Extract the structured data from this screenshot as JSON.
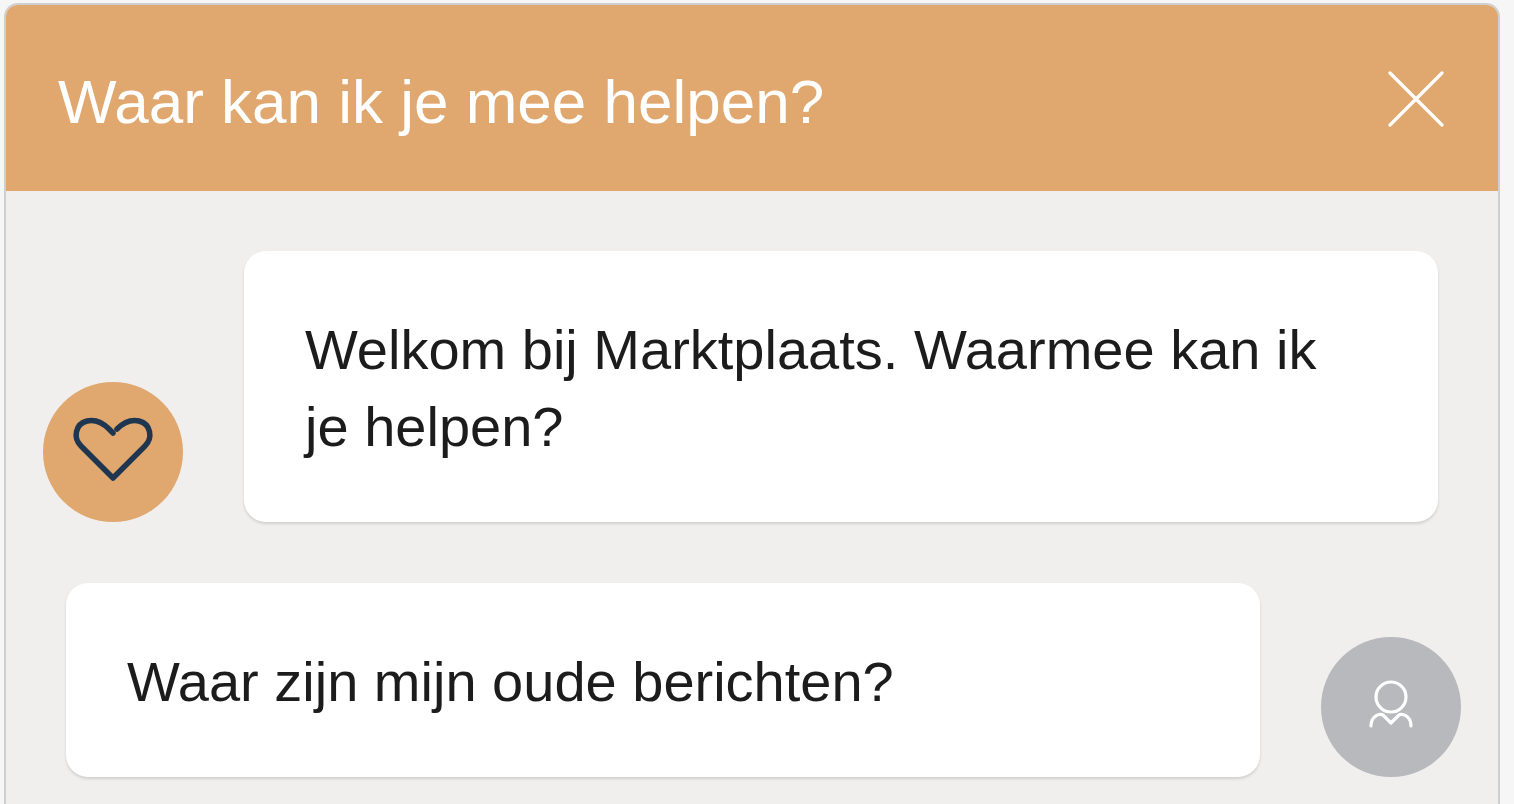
{
  "window": {
    "title": "Waar kan ik je mee helpen?"
  },
  "messages": [
    {
      "kind": "bot",
      "text": "Welkom bij Marktplaats. Waarmee kan ik je helpen?"
    },
    {
      "kind": "user",
      "text": "Waar zijn mijn oude berichten?"
    }
  ]
}
